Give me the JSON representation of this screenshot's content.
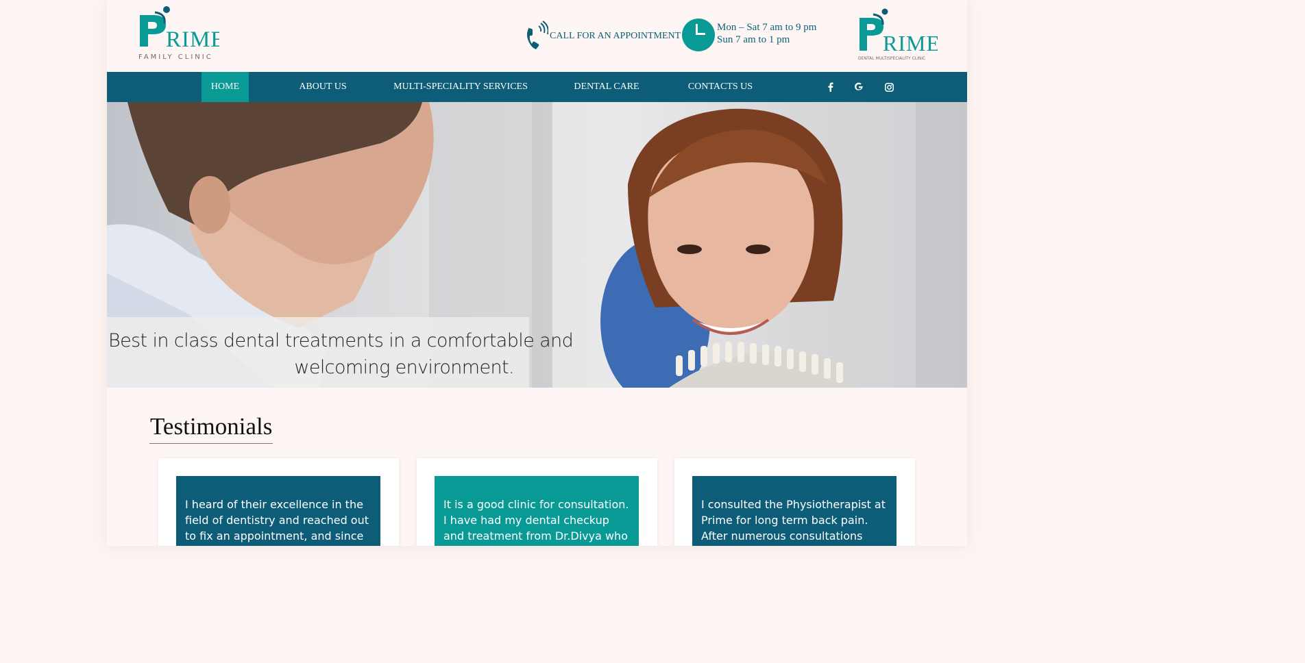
{
  "header": {
    "logo_left": {
      "brand": "PRIME",
      "tagline": "FAMILY CLINIC"
    },
    "logo_right": {
      "brand": "PRIME",
      "tagline": "DENTAL MULTISPECIALITY CLINIC"
    },
    "call_label": "CALL FOR AN APPOINTMENT",
    "hours_line1": "Mon – Sat 7 am to 9 pm",
    "hours_line2": "Sun 7 am to 1 pm",
    "icons": {
      "phone": "phone-icon",
      "clock": "clock-icon"
    }
  },
  "nav": {
    "items": [
      {
        "label": "HOME",
        "active": true
      },
      {
        "label": "ABOUT US",
        "active": false
      },
      {
        "label": "MULTI-SPECIALITY SERVICES",
        "active": false
      },
      {
        "label": "DENTAL CARE",
        "active": false
      },
      {
        "label": "CONTACTS US",
        "active": false
      }
    ],
    "social": {
      "facebook": "f",
      "google": "G",
      "instagram": "instagram-icon"
    }
  },
  "hero": {
    "caption_line1": "Best in class dental treatments in a comfortable and",
    "caption_line2": "welcoming environment."
  },
  "testimonials": {
    "title": "Testimonials",
    "cards": [
      {
        "text": "I heard of their excellence in the field of dentistry and reached out to fix an appointment, and since"
      },
      {
        "text": "It is a good clinic for consultation. I have had my dental checkup and treatment from Dr.Divya who is"
      },
      {
        "text": "I consulted the Physiotherapist at Prime for long term back pain. After numerous consultations with"
      }
    ]
  },
  "colors": {
    "navy": "#0e5d78",
    "teal": "#0a9a96",
    "background": "#fef6f4"
  }
}
